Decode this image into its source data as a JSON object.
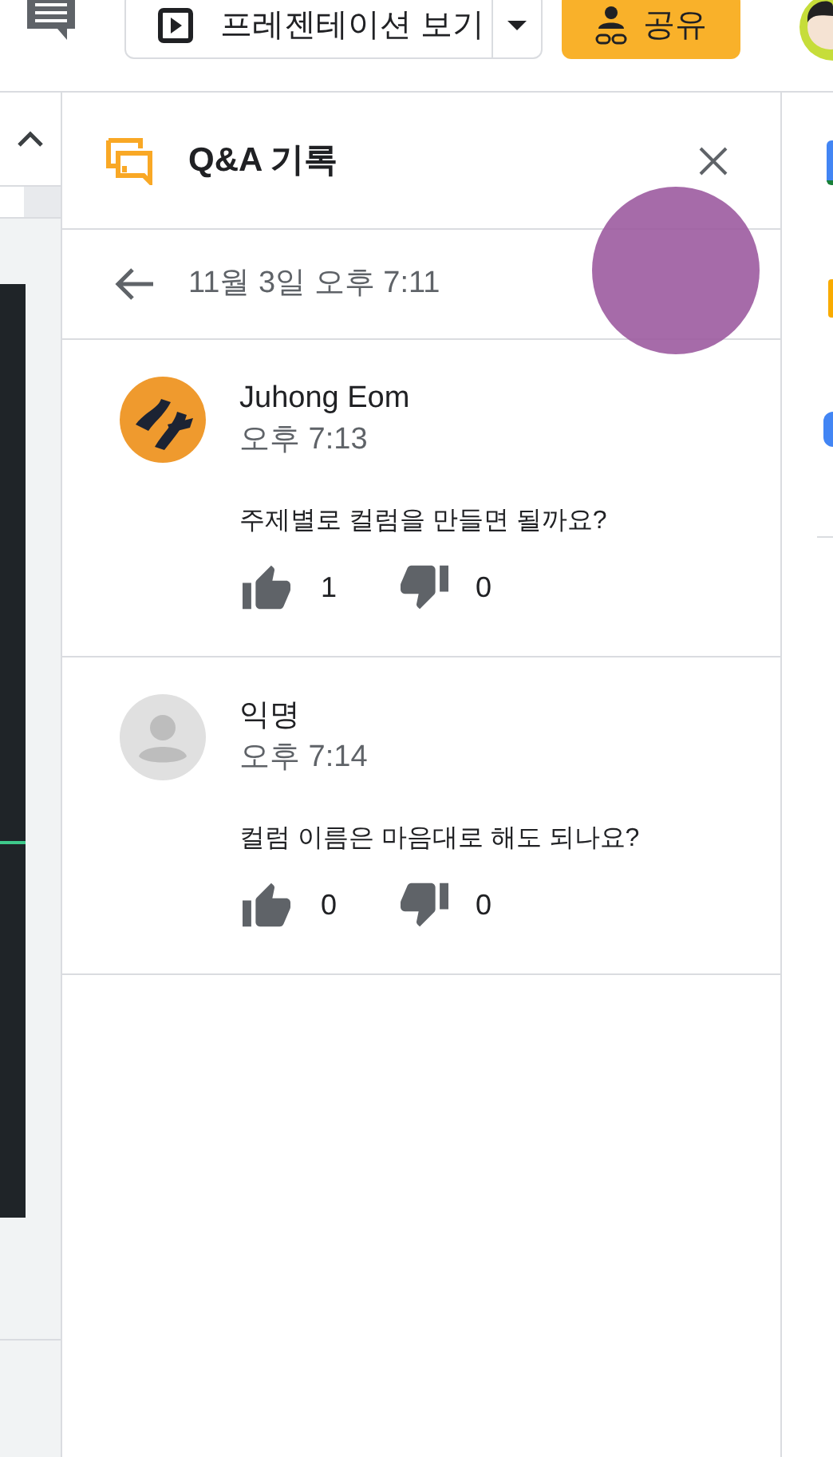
{
  "toolbar": {
    "present_button": {
      "label": "프레젠테이션 보기"
    },
    "share_button": {
      "label": "공유"
    }
  },
  "panel": {
    "title": "Q&A 기록",
    "session": {
      "label": "11월 3일 오후 7:11"
    },
    "questions": [
      {
        "author": "Juhong Eom",
        "time": "오후 7:13",
        "text": "주제별로 컬럼을 만들면 될까요?",
        "likes": "1",
        "dislikes": "0",
        "avatar": {
          "kind": "logo"
        }
      },
      {
        "author": "익명",
        "time": "오후 7:14",
        "text": "컬럼 이름은 마음대로 해도 되나요?",
        "likes": "0",
        "dislikes": "0",
        "avatar": {
          "kind": "anonymous"
        }
      }
    ]
  }
}
